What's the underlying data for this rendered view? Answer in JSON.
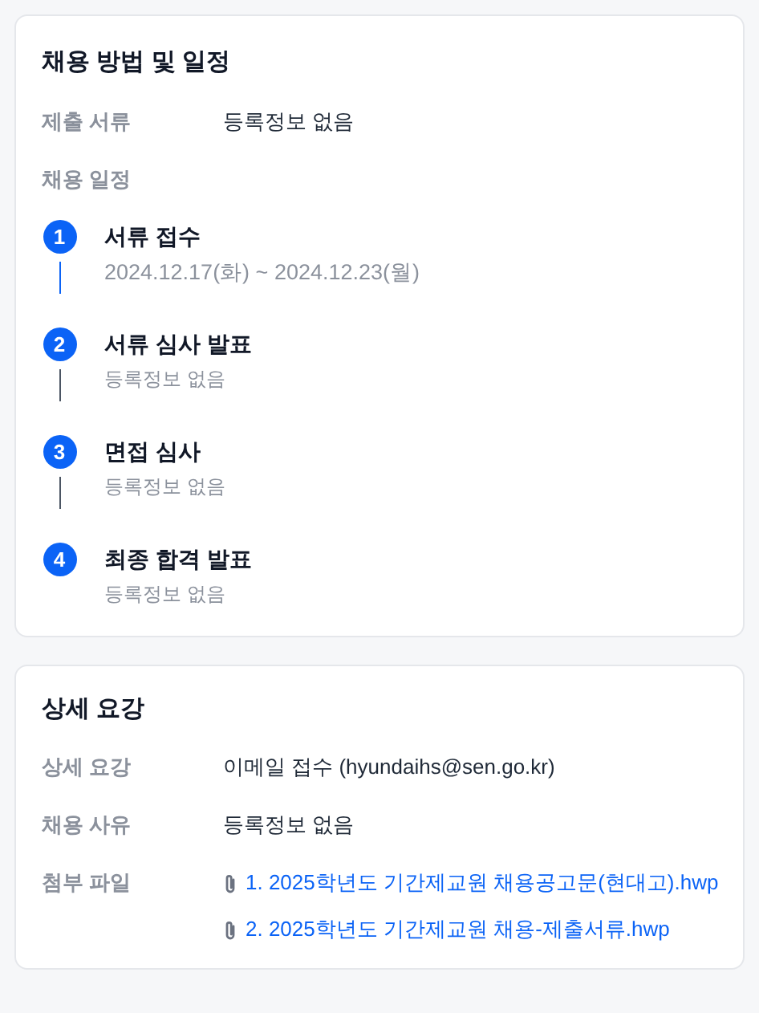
{
  "schedule_card": {
    "title": "채용 방법 및 일정",
    "documents": {
      "label": "제출 서류",
      "value": "등록정보 없음"
    },
    "schedule_label": "채용 일정",
    "steps": [
      {
        "number": "1",
        "title": "서류 접수",
        "detail": "2024.12.17(화) ~ 2024.12.23(월)",
        "active": true
      },
      {
        "number": "2",
        "title": "서류 심사 발표",
        "detail": "등록정보 없음",
        "active": false
      },
      {
        "number": "3",
        "title": "면접 심사",
        "detail": "등록정보 없음",
        "active": false
      },
      {
        "number": "4",
        "title": "최종 합격 발표",
        "detail": "등록정보 없음",
        "active": false
      }
    ]
  },
  "details_card": {
    "title": "상세 요강",
    "rows": [
      {
        "label": "상세 요강",
        "value": "이메일 접수 (hyundaihs@sen.go.kr)"
      },
      {
        "label": "채용 사유",
        "value": "등록정보 없음"
      }
    ],
    "attachments": {
      "label": "첨부 파일",
      "files": [
        "1. 2025학년도 기간제교원 채용공고문(현대고).hwp",
        "2. 2025학년도 기간제교원 채용-제출서류.hwp"
      ]
    }
  }
}
